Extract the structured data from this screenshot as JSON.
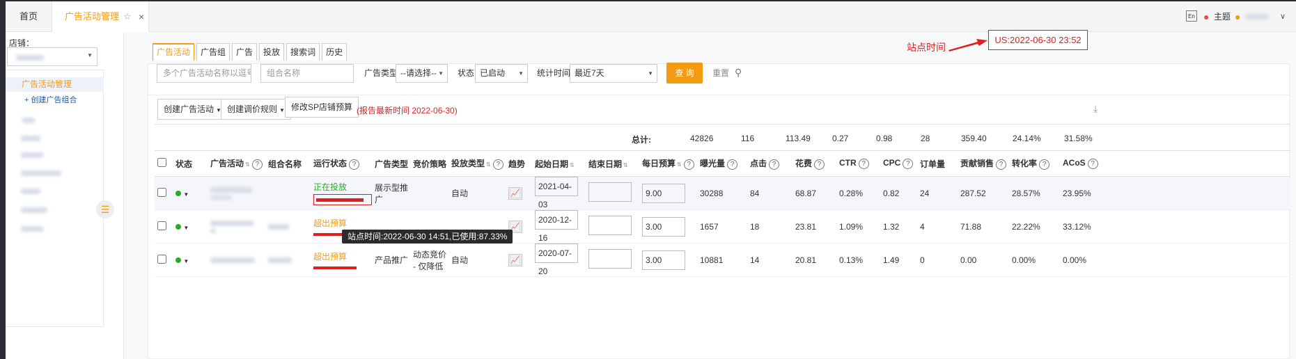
{
  "tabs": {
    "home": "首页",
    "active": "广告活动管理"
  },
  "topbar": {
    "theme_label": "主题"
  },
  "sidebar": {
    "shop_label": "店铺：",
    "menu_active": "广告活动管理",
    "menu_sub": "+ 创建广告组合"
  },
  "subtabs": [
    "广告活动",
    "广告组",
    "广告",
    "投放",
    "搜索词",
    "历史"
  ],
  "annotation": {
    "site_time_label": "站点时间",
    "site_time_box": "US:2022-06-30 23:52"
  },
  "filters": {
    "campaign_placeholder": "多个广告活动名称以逗号隔开",
    "portfolio_placeholder": "组合名称",
    "ad_type_label": "广告类型",
    "ad_type_value": "--请选择--",
    "status_label": "状态",
    "status_value": "已启动",
    "stat_time_label": "统计时间",
    "stat_time_value": "最近7天",
    "search_label": "查 询",
    "reset_label": "重置"
  },
  "actions": {
    "create": "创建广告活动",
    "rules": "创建调价规则",
    "budget": "修改SP店铺预算",
    "report_note": "(报告最新时间 2022-06-30)"
  },
  "totals": {
    "label": "总计:",
    "impressions": "42826",
    "clicks": "116",
    "spend": "113.49",
    "ctr": "0.27",
    "cpc": "0.98",
    "orders": "28",
    "sales": "359.40",
    "cvr": "24.14%",
    "acos": "31.58%"
  },
  "columns": [
    "状态",
    "广告活动",
    "组合名称",
    "运行状态",
    "广告类型",
    "竞价策略",
    "投放类型",
    "趋势",
    "起始日期",
    "结束日期",
    "每日预算",
    "曝光量",
    "点击",
    "花费",
    "CTR",
    "CPC",
    "订单量",
    "贡献销售",
    "转化率",
    "ACoS"
  ],
  "rows": [
    {
      "run_status": "正在投放",
      "ad_type": "展示型推广",
      "bid": "",
      "target": "自动",
      "start": "2021-04-03",
      "budget": "9.00",
      "impressions": "30288",
      "clicks": "84",
      "spend": "68.87",
      "ctr": "0.28%",
      "cpc": "0.82",
      "orders": "24",
      "sales": "287.52",
      "cvr": "28.57%",
      "acos": "23.95%"
    },
    {
      "run_status": "超出预算",
      "ad_type": "",
      "bid": "",
      "target": "",
      "start": "2020-12-16",
      "budget": "3.00",
      "impressions": "1657",
      "clicks": "18",
      "spend": "23.81",
      "ctr": "1.09%",
      "cpc": "1.32",
      "orders": "4",
      "sales": "71.88",
      "cvr": "22.22%",
      "acos": "33.12%"
    },
    {
      "run_status": "超出预算",
      "ad_type": "产品推广",
      "bid": "动态竞价 - 仅降低",
      "target": "自动",
      "start": "2020-07-20",
      "budget": "3.00",
      "impressions": "10881",
      "clicks": "14",
      "spend": "20.81",
      "ctr": "0.13%",
      "cpc": "1.49",
      "orders": "0",
      "sales": "0.00",
      "cvr": "0.00%",
      "acos": "0.00%"
    }
  ],
  "tooltip": "站点时间:2022-06-30 14:51,已使用:87.33%",
  "colors": {
    "accent": "#f39c12",
    "status_green": "#27ae20",
    "red": "#e02020"
  }
}
